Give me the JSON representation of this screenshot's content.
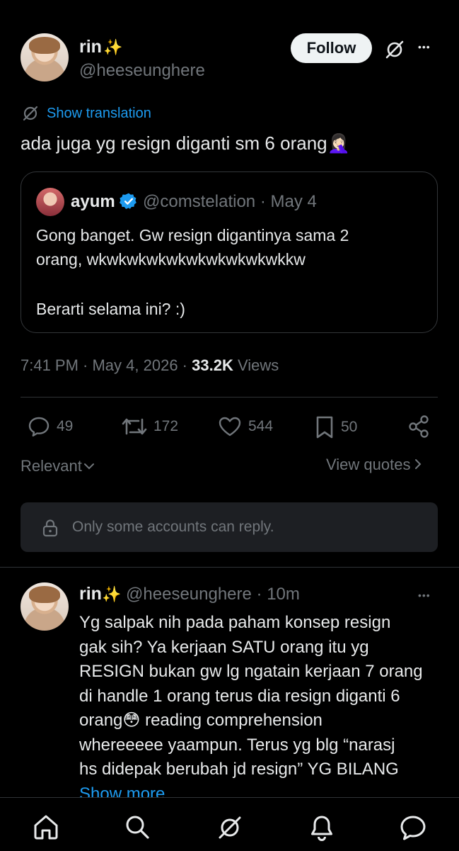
{
  "tweet": {
    "author_name": "rin",
    "author_emoji": "✨",
    "author_handle": "@heeseunghere",
    "follow_label": "Follow",
    "more_label": "•••",
    "show_translation": "Show translation",
    "text": "ada juga yg resign diganti sm 6 orang🤦🏻‍♀️",
    "quoted": {
      "name": "ayum",
      "handle": "@comstelation",
      "date": "· May 4",
      "line1": "Gong banget. Gw resign digantinya sama 2",
      "line2": "orang, wkwkwkwkwkwkwkwkwkwkkw",
      "line3": "Berarti selama ini? :)"
    },
    "timestamp": "7:41 PM · May 4, 2026 ·",
    "views_count": "33.2K",
    "views_label": "Views",
    "stats": {
      "replies": "49",
      "retweets": "172",
      "likes": "544",
      "bookmarks": "50"
    },
    "relevant_label": "Relevant",
    "view_quotes_label": "View quotes",
    "reply_restriction": "Only some accounts can reply."
  },
  "reply": {
    "author_name": "rin",
    "author_emoji": "✨",
    "author_handle": "@heeseunghere",
    "time": "· 10m",
    "more_label": "•••",
    "lines": [
      "Yg salpak nih pada paham konsep resign",
      "gak sih? Ya kerjaan SATU orang itu yg",
      "RESIGN bukan gw lg ngatain kerjaan 7 orang",
      "di handle 1 orang terus dia resign diganti 6",
      "orang😳 reading comprehension",
      "whereeeee yaampun. Terus yg blg “narasj",
      "hs didepak berubah jd resign” YG BILANG"
    ],
    "show_more": "Show more"
  },
  "nav": [
    "home-icon",
    "search-icon",
    "grok-icon",
    "notifications-icon",
    "messages-icon"
  ],
  "colors": {
    "background": "#000000",
    "text": "#e7e9ea",
    "muted": "#71767b",
    "link": "#1d9bf0",
    "divider": "#2f3336"
  }
}
